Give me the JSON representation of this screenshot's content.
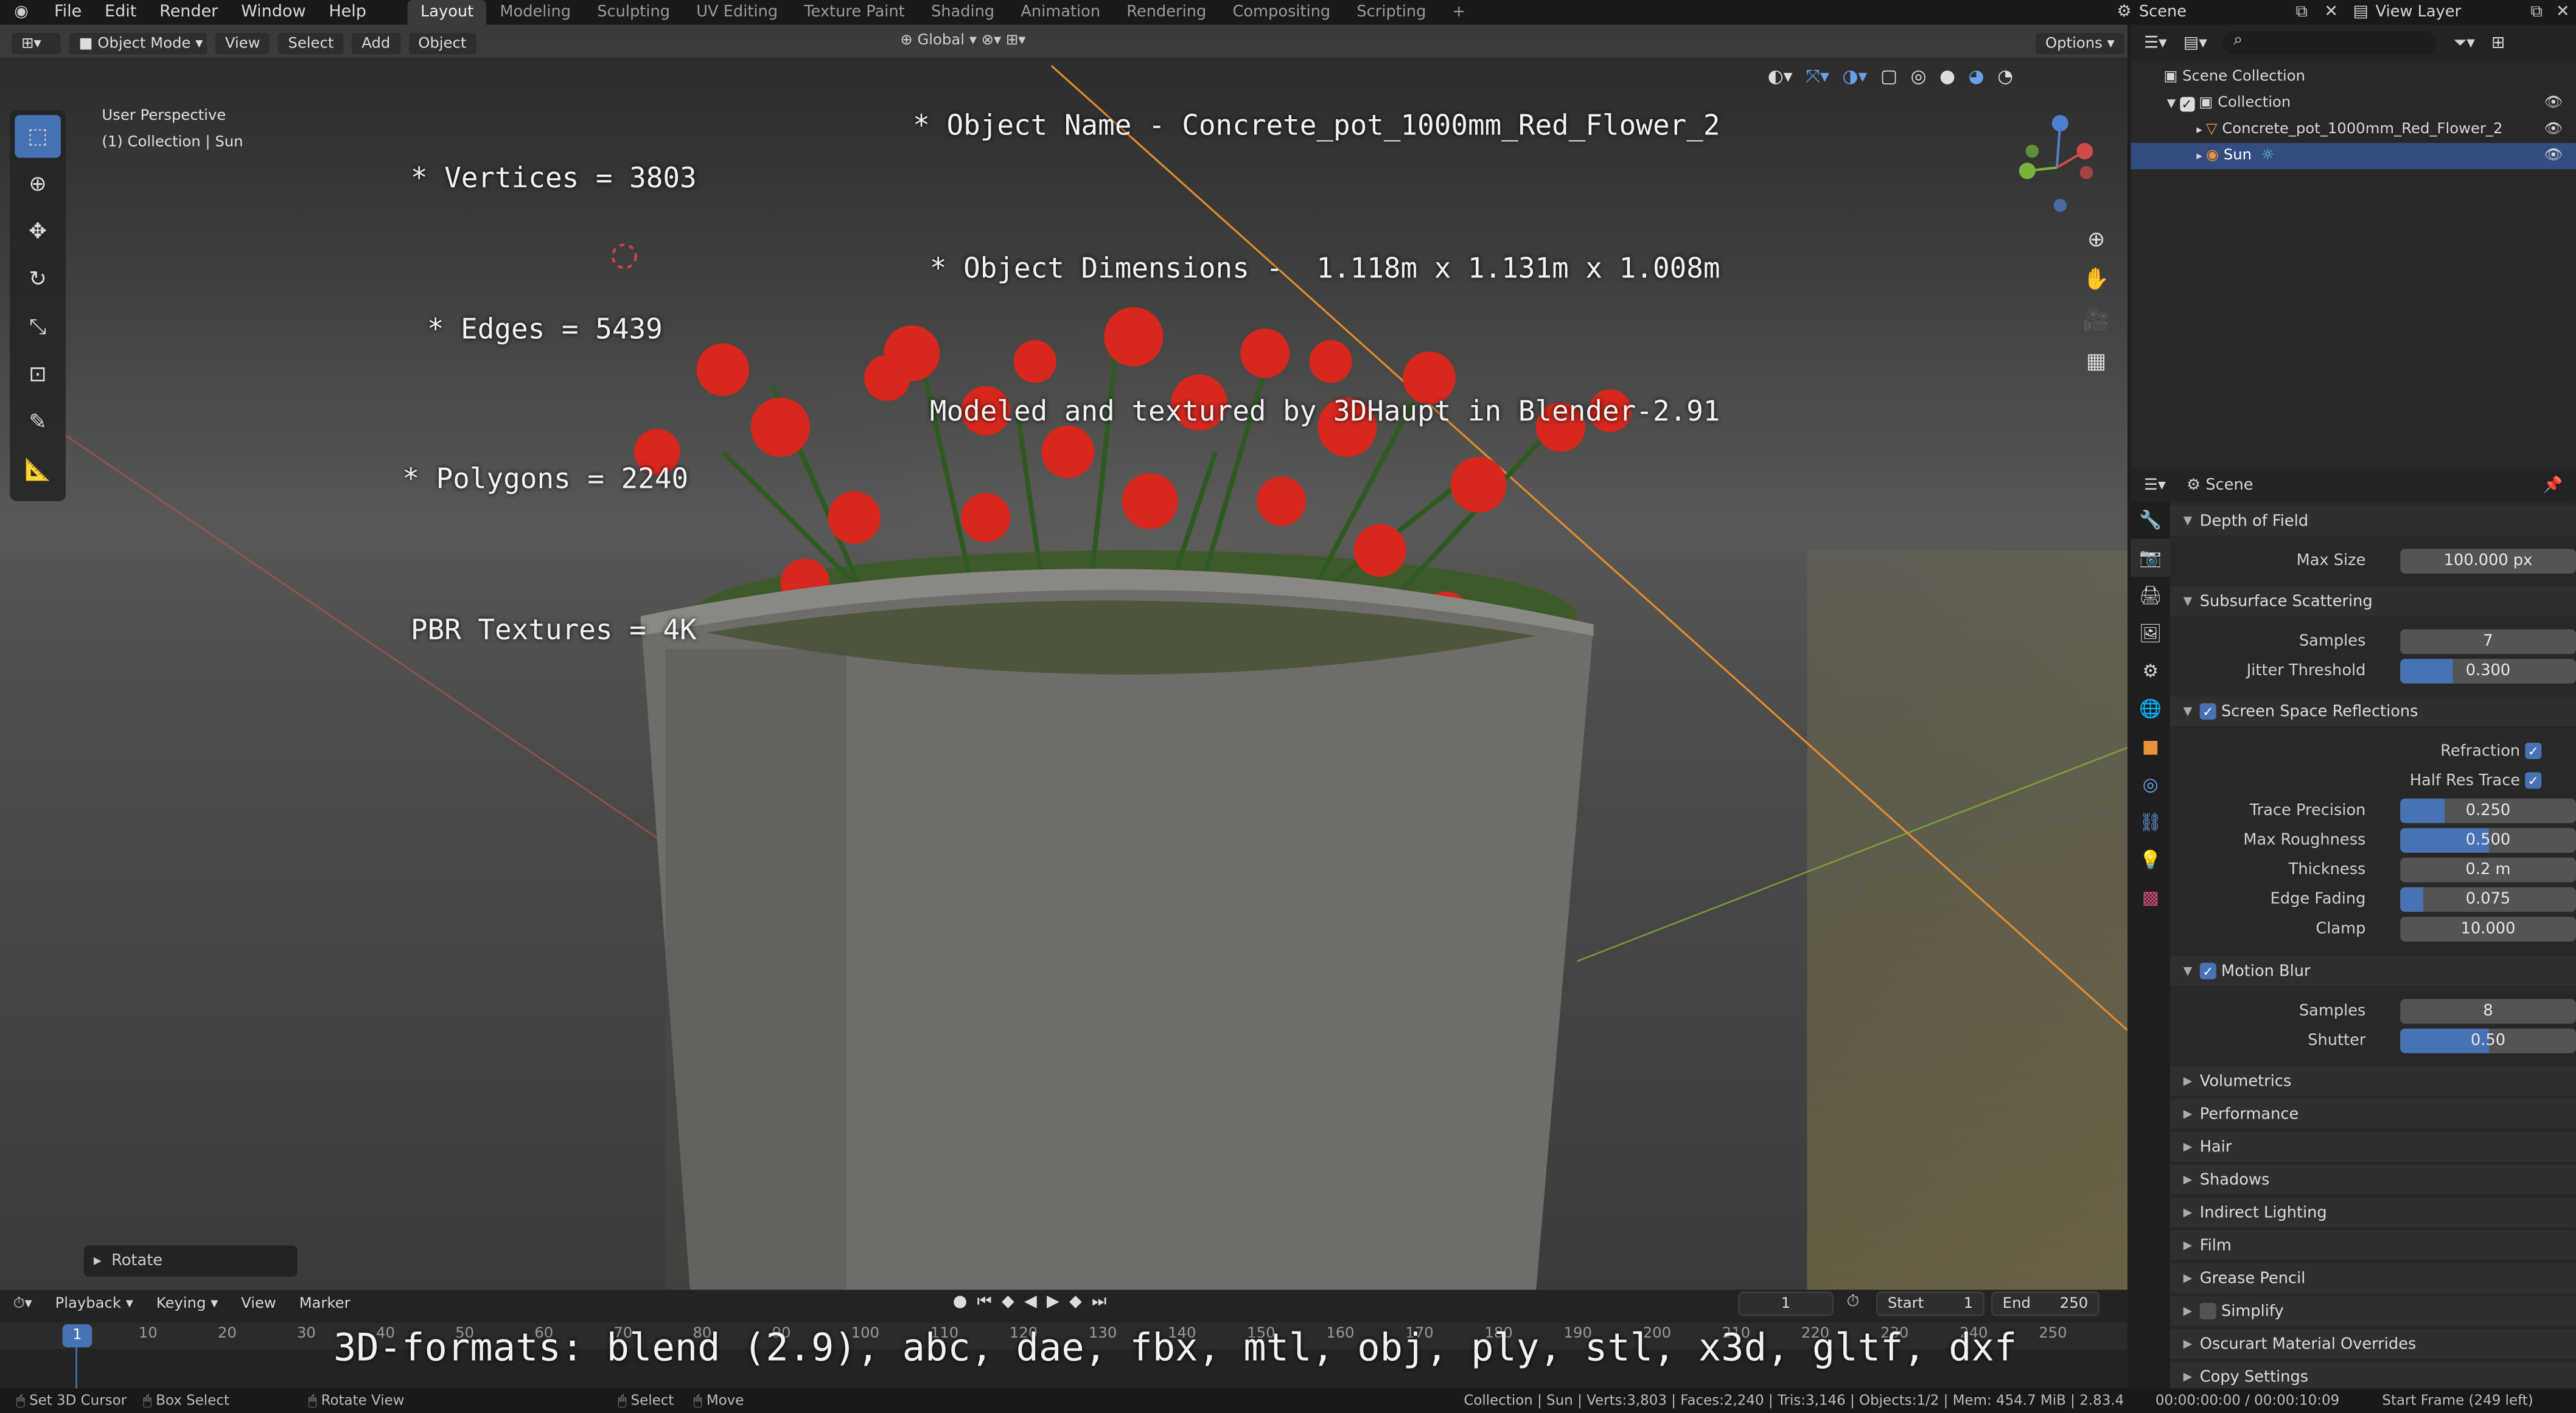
{
  "menu": {
    "items": [
      "File",
      "Edit",
      "Render",
      "Window",
      "Help"
    ]
  },
  "workspaces": [
    "Layout",
    "Modeling",
    "Sculpting",
    "UV Editing",
    "Texture Paint",
    "Shading",
    "Animation",
    "Rendering",
    "Compositing",
    "Scripting"
  ],
  "top_right": {
    "scene": "Scene",
    "view_layer": "View Layer"
  },
  "viewport": {
    "mode": "Object Mode",
    "menus": [
      "View",
      "Select",
      "Add",
      "Object"
    ],
    "transform_orientation": "Global",
    "options": "Options",
    "perspective": "User Perspective",
    "collection_label": "(1) Collection | Sun",
    "overlay_left": [
      "* Vertices = 3803",
      "* Edges = 5439",
      "* Polygons = 2240",
      "PBR Textures = 4K"
    ],
    "overlay_right": [
      "* Object Name - Concrete_pot_1000mm_Red_Flower_2",
      "* Object Dimensions -  1.118m x 1.131m x 1.008m",
      "Modeled and textured by 3DHaupt in Blender-2.91"
    ],
    "last_op": "Rotate",
    "formats": "3D-formats: blend (2.9), abc, dae, fbx, mtl, obj, ply, stl, x3d, gltf, dxf"
  },
  "outliner": {
    "root": "Scene Collection",
    "collection": "Collection",
    "objects": [
      "Concrete_pot_1000mm_Red_Flower_2",
      "Sun"
    ]
  },
  "properties": {
    "context": "Scene",
    "panels": [
      {
        "title": "Depth of Field",
        "open": true,
        "fields": [
          {
            "label": "Max Size",
            "value": "100.000 px",
            "fill": 0
          }
        ]
      },
      {
        "title": "Subsurface Scattering",
        "open": true,
        "fields": [
          {
            "label": "Samples",
            "value": "7",
            "fill": 0
          },
          {
            "label": "Jitter Threshold",
            "value": "0.300",
            "fill": 0.3
          }
        ]
      },
      {
        "title": "Screen Space Reflections",
        "open": true,
        "checkbox": true,
        "checks": [
          {
            "label": "Refraction",
            "on": true
          },
          {
            "label": "Half Res Trace",
            "on": true
          }
        ],
        "fields": [
          {
            "label": "Trace Precision",
            "value": "0.250",
            "fill": 0.25
          },
          {
            "label": "Max Roughness",
            "value": "0.500",
            "fill": 0.5
          },
          {
            "label": "Thickness",
            "value": "0.2 m",
            "fill": 0
          },
          {
            "label": "Edge Fading",
            "value": "0.075",
            "fill": 0.13
          },
          {
            "label": "Clamp",
            "value": "10.000",
            "fill": 0
          }
        ]
      },
      {
        "title": "Motion Blur",
        "open": true,
        "checkbox": true,
        "fields": [
          {
            "label": "Samples",
            "value": "8",
            "fill": 0
          },
          {
            "label": "Shutter",
            "value": "0.50",
            "fill": 0.5
          }
        ]
      }
    ],
    "closed_panels": [
      "Volumetrics",
      "Performance",
      "Hair",
      "Shadows",
      "Indirect Lighting",
      "Film",
      "Grease Pencil",
      "Simplify",
      "Oscurart Material Overrides",
      "Copy Settings"
    ]
  },
  "timeline": {
    "menus": [
      "Playback",
      "Keying",
      "View",
      "Marker"
    ],
    "current": "1",
    "start_label": "Start",
    "start": "1",
    "end_label": "End",
    "end": "250",
    "ticks": [
      "1",
      "10",
      "20",
      "30",
      "40",
      "50",
      "60",
      "70",
      "80",
      "90",
      "100",
      "110",
      "120",
      "130",
      "140",
      "150",
      "160",
      "170",
      "180",
      "190",
      "200",
      "210",
      "220",
      "230",
      "240",
      "250"
    ]
  },
  "status": {
    "left": [
      "Set 3D Cursor",
      "Box Select",
      "Rotate View",
      "Select",
      "Move"
    ],
    "stats": "Collection | Sun | Verts:3,803 | Faces:2,240 | Tris:3,146 | Objects:1/2 | Mem: 454.7 MiB | 2.83.4",
    "time": "00:00:00:00 / 00:00:10:09",
    "frame": "Start Frame (249 left)"
  }
}
